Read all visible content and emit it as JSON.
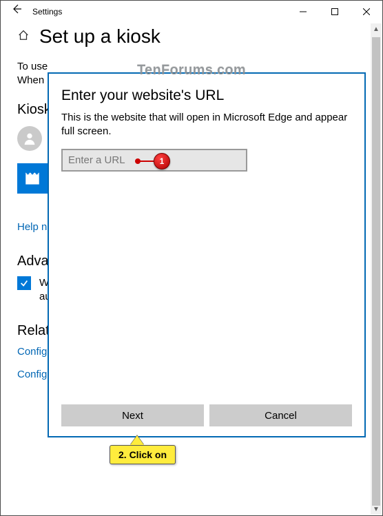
{
  "titlebar": {
    "title": "Settings"
  },
  "page": {
    "heading": "Set up a kiosk",
    "intro_line1": "To use",
    "intro_line2": "When",
    "kiosk_heading": "Kiosk",
    "help_link": "Help n",
    "adv_heading": "Adva",
    "checkbox_line1": "W",
    "checkbox_line2": "au",
    "related_heading": "Related setti",
    "related_link1": "Configure power and sleep settings",
    "related_link2": "Configure active hours"
  },
  "dialog": {
    "title": "Enter your website's URL",
    "desc": "This is the website that will open in Microsoft Edge and appear full screen.",
    "url_placeholder": "Enter a URL",
    "url_value": "",
    "next": "Next",
    "cancel": "Cancel"
  },
  "watermark": "TenForums.com",
  "annotations": {
    "step1": "1",
    "step2": "2. Click on"
  }
}
